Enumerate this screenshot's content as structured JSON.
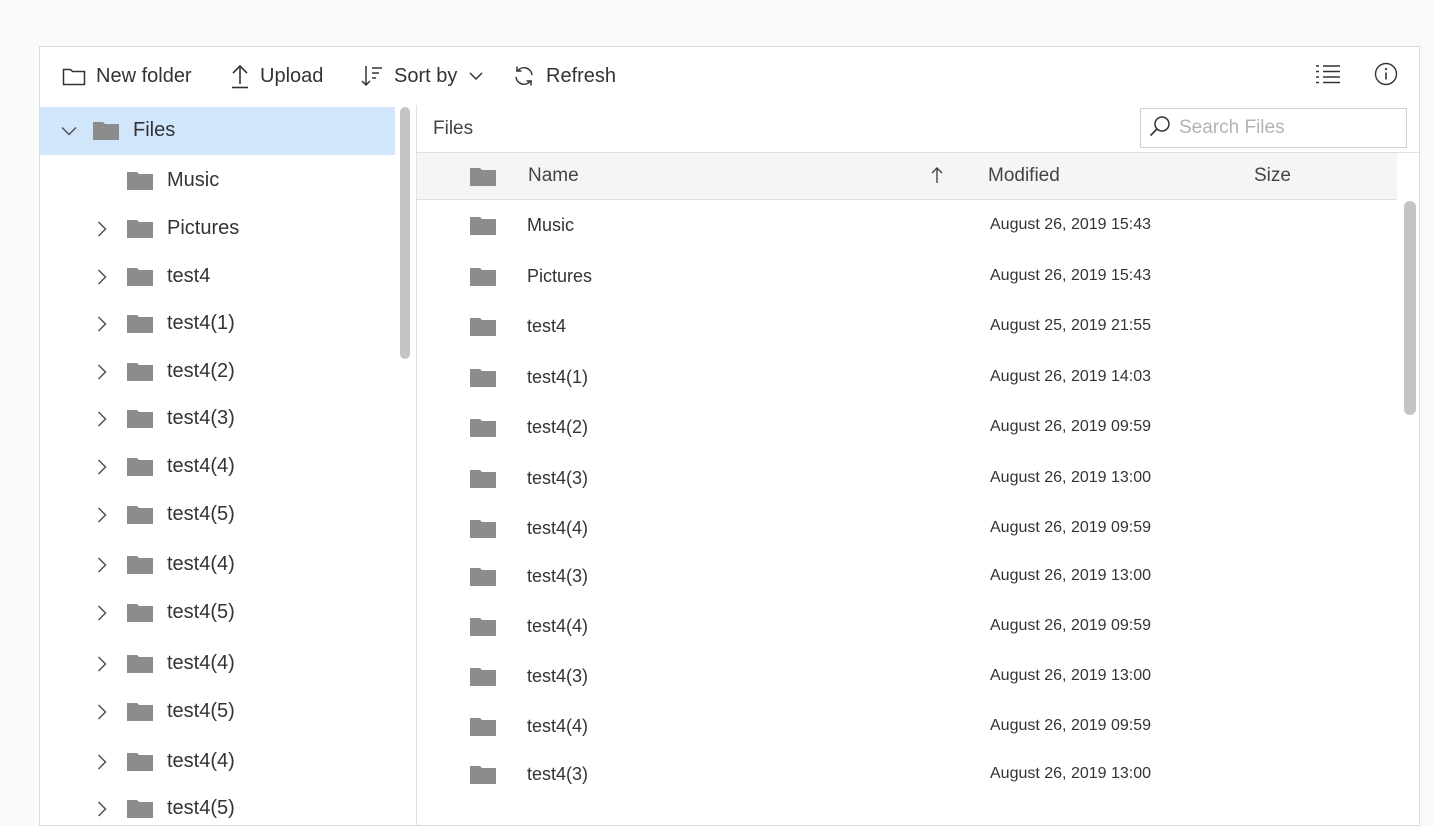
{
  "toolbar": {
    "new_folder": "New folder",
    "upload": "Upload",
    "sort_by": "Sort by",
    "refresh": "Refresh"
  },
  "navigation": {
    "root": "Files",
    "items": [
      {
        "label": "Music",
        "expandable": false
      },
      {
        "label": "Pictures",
        "expandable": true
      },
      {
        "label": "test4",
        "expandable": true
      },
      {
        "label": "test4(1)",
        "expandable": true
      },
      {
        "label": "test4(2)",
        "expandable": true
      },
      {
        "label": "test4(3)",
        "expandable": true
      },
      {
        "label": "test4(4)",
        "expandable": true
      },
      {
        "label": "test4(5)",
        "expandable": true
      },
      {
        "label": "test4(4)",
        "expandable": true
      },
      {
        "label": "test4(5)",
        "expandable": true
      },
      {
        "label": "test4(4)",
        "expandable": true
      },
      {
        "label": "test4(5)",
        "expandable": true
      },
      {
        "label": "test4(4)",
        "expandable": true
      },
      {
        "label": "test4(5)",
        "expandable": true
      }
    ]
  },
  "address": {
    "breadcrumb": "Files"
  },
  "search": {
    "placeholder": "Search Files",
    "value": ""
  },
  "grid": {
    "columns": {
      "name": "Name",
      "modified": "Modified",
      "size": "Size"
    },
    "sort": {
      "column": "Name",
      "direction": "ascending"
    },
    "rows": [
      {
        "name": "Music",
        "modified": "August 26, 2019 15:43",
        "size": ""
      },
      {
        "name": "Pictures",
        "modified": "August 26, 2019 15:43",
        "size": ""
      },
      {
        "name": "test4",
        "modified": "August 25, 2019 21:55",
        "size": ""
      },
      {
        "name": "test4(1)",
        "modified": "August 26, 2019 14:03",
        "size": ""
      },
      {
        "name": "test4(2)",
        "modified": "August 26, 2019 09:59",
        "size": ""
      },
      {
        "name": "test4(3)",
        "modified": "August 26, 2019 13:00",
        "size": ""
      },
      {
        "name": "test4(4)",
        "modified": "August 26, 2019 09:59",
        "size": ""
      },
      {
        "name": "test4(3)",
        "modified": "August 26, 2019 13:00",
        "size": ""
      },
      {
        "name": "test4(4)",
        "modified": "August 26, 2019 09:59",
        "size": ""
      },
      {
        "name": "test4(3)",
        "modified": "August 26, 2019 13:00",
        "size": ""
      },
      {
        "name": "test4(4)",
        "modified": "August 26, 2019 09:59",
        "size": ""
      },
      {
        "name": "test4(3)",
        "modified": "August 26, 2019 13:00",
        "size": ""
      }
    ]
  },
  "colors": {
    "selected_bg": "#cfe6fb",
    "folder_icon": "#8c8c8c",
    "header_bg": "#f5f5f5",
    "scrollbar": "#c4c4c4"
  },
  "icons": {
    "new_folder": "folder-outline-icon",
    "upload": "upload-arrow-icon",
    "sort": "sort-descending-icon",
    "refresh": "refresh-icon",
    "view": "details-view-icon",
    "info": "info-icon",
    "folder": "folder-icon",
    "search": "search-icon"
  }
}
